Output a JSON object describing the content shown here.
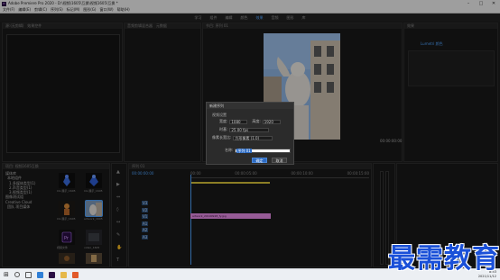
{
  "title": "Adobe Premiere Pro 2020 - D:\\视频\\1605\\互换\\视频1605\\互换 *",
  "menu": [
    "文件(F)",
    "编辑(E)",
    "剪辑(C)",
    "序列(S)",
    "标记(M)",
    "图形(G)",
    "窗口(W)",
    "帮助(H)"
  ],
  "workspaces": [
    "学习",
    "组件",
    "编辑",
    "颜色",
    "效果",
    "音频",
    "图形",
    "库"
  ],
  "active_workspace": "效果",
  "source_panel_tab": "源:(无剪辑)",
  "fx_tab": "效果控件",
  "audio_tab": "音频剪辑混合器",
  "meta_tab": "元数据",
  "program_tab": "节目: 序列 01",
  "program_timecode": "00:00:00:00",
  "fx_panel_title": "效果",
  "fx_panel_tab": "Lumetri 颜色",
  "dialog": {
    "title": "新建序列",
    "section": "视频设置",
    "width_label": "宽度:",
    "width_value": "1080",
    "height_label": "高度:",
    "height_value": "1920",
    "fps_label": "时基:",
    "fps_value": "25.00 fps",
    "aspect_label": "像素长宽比:",
    "aspect_value": "方形像素 (1.0)",
    "name_label": "名称:",
    "name_value": "序列 01",
    "ok": "确定",
    "cancel": "取消"
  },
  "project": {
    "title": "项目: 视频1605互换",
    "tree": [
      "媒体库",
      "本地组件",
      "1.多媒体类型(1)",
      "2.声音类型(1)",
      "3.视频类型(1)",
      "图像测试组",
      "Creative Cloud",
      "团队 项目媒体"
    ],
    "items": [
      {
        "name": "CG 展示_1605",
        "icon": "blue-figure-icon"
      },
      {
        "name": "CG 展示_1605",
        "icon": "blue-figure-icon"
      },
      {
        "name": "",
        "icon": "photo-icon"
      },
      {
        "name": "CG 展示_1605",
        "icon": "orange-figure-icon"
      },
      {
        "name": "artwork_1605",
        "icon": "statue-photo-icon"
      },
      {
        "name": "",
        "icon": "dark-photo-icon"
      },
      {
        "name": "视频文件",
        "icon": "premiere-icon"
      },
      {
        "name": "video_1605",
        "icon": "dark-clip-icon"
      },
      {
        "name": "",
        "icon": "dark-photo-icon"
      },
      {
        "name": "",
        "icon": "small-photo-icon"
      }
    ]
  },
  "timeline": {
    "tab": "序列 01",
    "timecode": "00:00:00:00",
    "ruler": [
      "00:00",
      "00:00:05:00",
      "00:00:10:00",
      "00:00:15:00"
    ],
    "tracks": [
      "V3",
      "V2",
      "V1",
      "A1",
      "A2",
      "A3"
    ],
    "clip": "artwork_20190928_fy.jpg"
  },
  "taskbar_time": "8:53",
  "taskbar_date": "2021/11/12",
  "watermark": "最需教育",
  "colors": {
    "accent": "#4fa3ff",
    "clip": "#e68ce6",
    "playhead": "#4fa3ff"
  }
}
